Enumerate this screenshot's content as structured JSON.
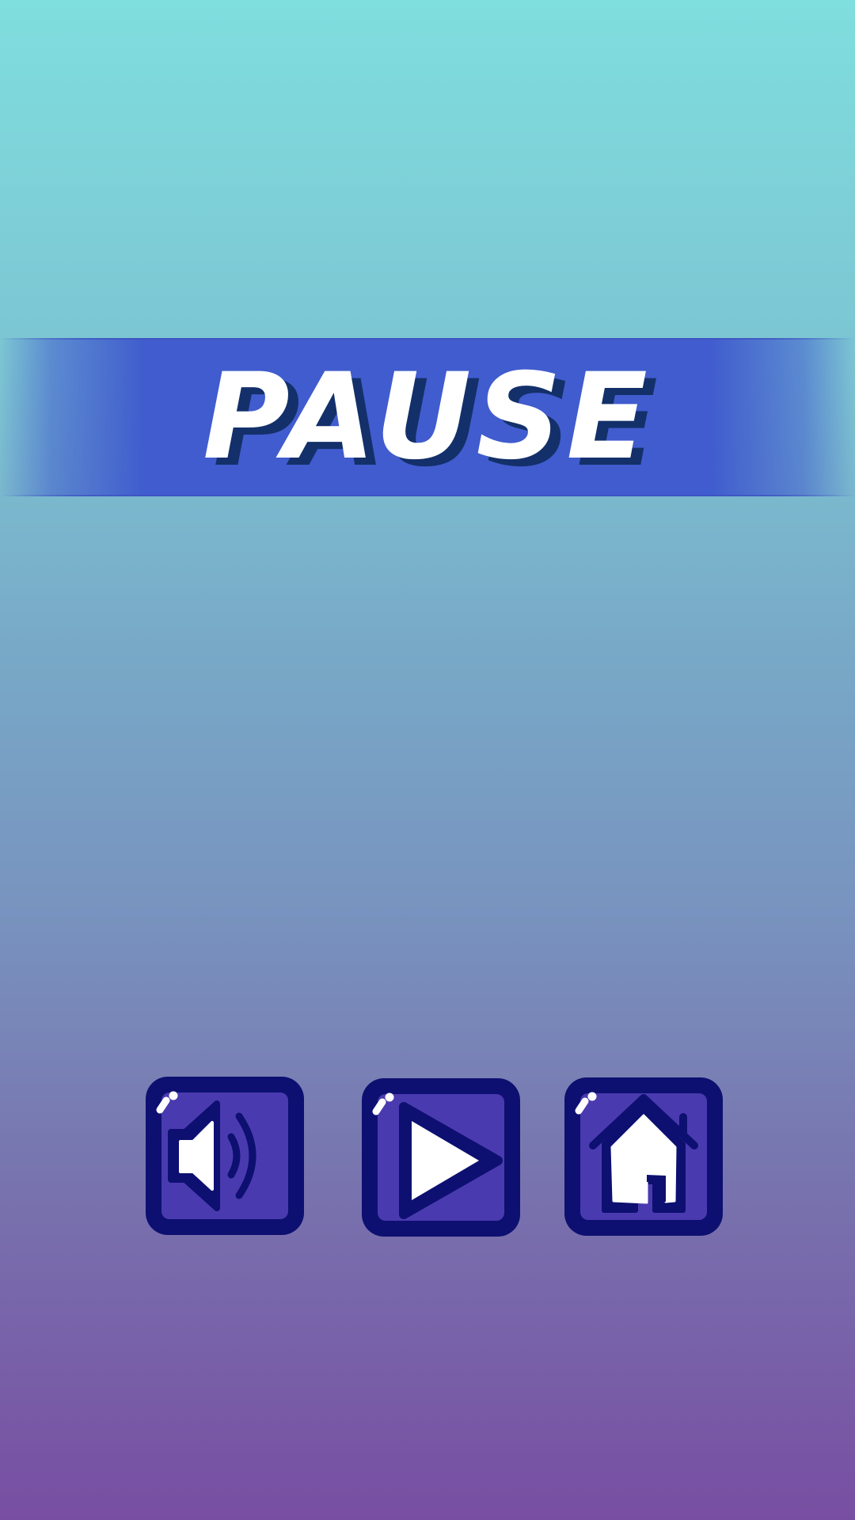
{
  "pause_screen": {
    "title": "PAUSE",
    "colors": {
      "background_top": "#7fdede",
      "background_bottom": "#784ea2",
      "banner": "#405cce",
      "title_text": "#ffffff",
      "title_shadow": "#13306a",
      "button_frame": "#0d1070",
      "button_face": "#4a3aaf",
      "icon_fill": "#ffffff"
    },
    "buttons": [
      {
        "id": "sound",
        "icon": "speaker-volume-icon"
      },
      {
        "id": "play",
        "icon": "play-icon"
      },
      {
        "id": "home",
        "icon": "home-icon"
      }
    ]
  }
}
